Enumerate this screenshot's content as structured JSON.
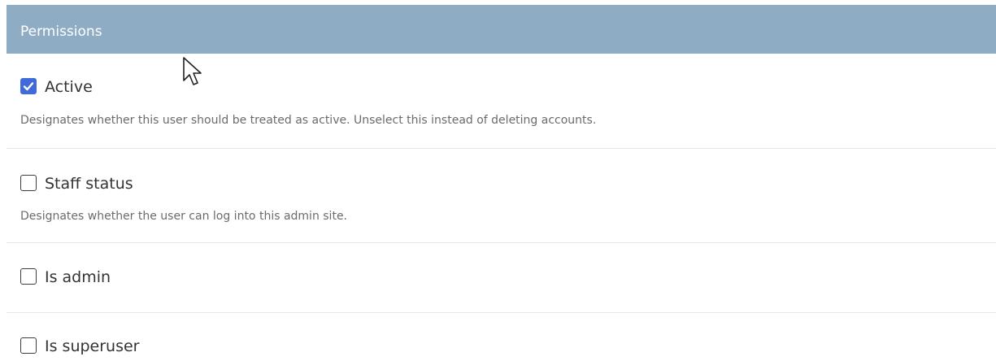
{
  "header": {
    "title": "Permissions"
  },
  "fields": [
    {
      "label": "Active",
      "checked": true,
      "help": "Designates whether this user should be treated as active. Unselect this instead of deleting accounts."
    },
    {
      "label": "Staff status",
      "checked": false,
      "help": "Designates whether the user can log into this admin site."
    },
    {
      "label": "Is admin",
      "checked": false
    },
    {
      "label": "Is superuser",
      "checked": false
    }
  ],
  "colors": {
    "header_background": "#8eadc5",
    "checkbox_checked": "#3f6ad8"
  },
  "icons": {
    "checkmark": "checkmark-icon",
    "cursor": "mouse-pointer-icon"
  }
}
